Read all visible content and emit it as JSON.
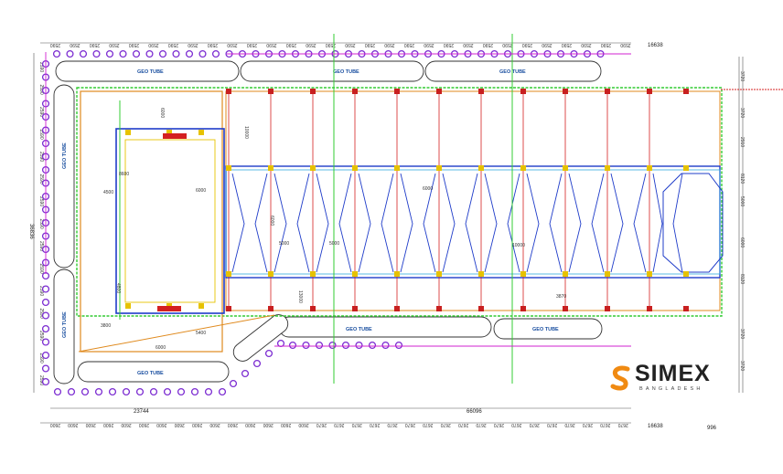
{
  "drawing": {
    "top_dims": [
      "2590",
      "2590",
      "2590",
      "2590",
      "2590",
      "2590",
      "2590",
      "2590",
      "2590",
      "2590",
      "2590",
      "2590",
      "2590",
      "2590",
      "2590",
      "2590",
      "2590",
      "2590",
      "2590",
      "2590",
      "2590",
      "2590",
      "2590",
      "2590",
      "2590",
      "2590",
      "2590",
      "2590",
      "2590",
      "2590"
    ],
    "top_total": "16638",
    "bottom_dims": [
      "2600",
      "2600",
      "2600",
      "2600",
      "2600",
      "2600",
      "2600",
      "2600",
      "2600",
      "2600",
      "2600",
      "2600",
      "2600",
      "2600",
      "2600",
      "2670",
      "2670",
      "2670",
      "2670",
      "2670",
      "2670",
      "2670",
      "2670",
      "2670",
      "2670",
      "2670",
      "2670",
      "2670",
      "2670",
      "2670",
      "2670",
      "2670",
      "2670"
    ],
    "bottom_left_total": "23744",
    "bottom_right_total": "66096",
    "bottom_end_total": "16638",
    "bottom_far_right": "996",
    "left_dims": [
      "2590",
      "2590",
      "2590",
      "2590",
      "2590",
      "2590",
      "2590",
      "2590",
      "2590",
      "2590",
      "2590",
      "2590",
      "2590",
      "2590",
      "2590"
    ],
    "left_total": "36836",
    "right_dims": [
      "3720",
      "3720",
      "2910",
      "8120",
      "5000",
      "6000",
      "8120",
      "3720",
      "3720"
    ],
    "tube_label": "GEO TUBE",
    "interior_labels": [
      "6000",
      "10000",
      "8600",
      "4500",
      "6000",
      "5000",
      "13000",
      "6000",
      "5400",
      "3800",
      "4800",
      "6000",
      "6000",
      "5000",
      "10000",
      "3870"
    ]
  },
  "colors": {
    "outline_red": "#d42020",
    "green": "#33cc33",
    "blue": "#1f3cc9",
    "orange": "#e08a1e",
    "purple": "#7b2bd1",
    "yellow": "#e6c200",
    "magenta": "#d020d0"
  },
  "logo": {
    "name": "SIMEX",
    "sub": "BANGLADESH",
    "mark_color": "#f08a12"
  }
}
